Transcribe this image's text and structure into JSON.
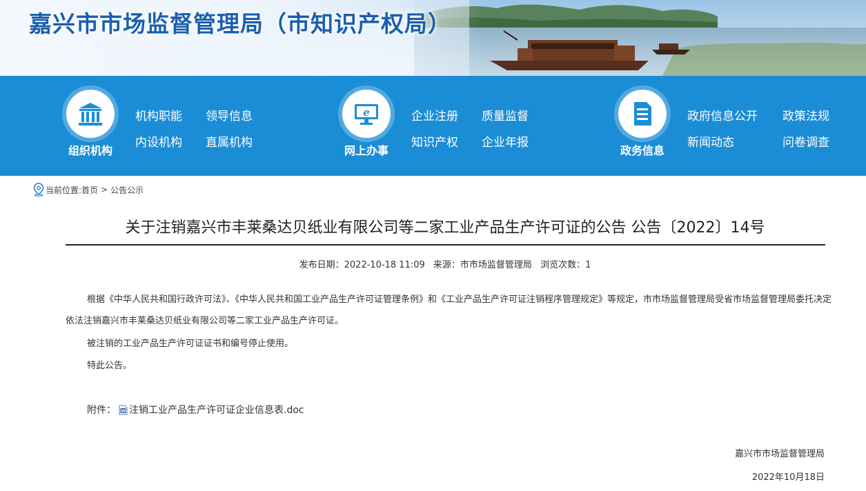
{
  "header": {
    "site_title": "嘉兴市市场监督管理局（市知识产权局）"
  },
  "nav": {
    "groups": [
      {
        "label": "组织机构",
        "icon": "building-columns-icon",
        "links": [
          "机构职能",
          "领导信息",
          "内设机构",
          "直属机构"
        ]
      },
      {
        "label": "网上办事",
        "icon": "monitor-e-icon",
        "links": [
          "企业注册",
          "质量监督",
          "知识产权",
          "企业年报"
        ]
      },
      {
        "label": "政务信息",
        "icon": "document-icon",
        "links": [
          "政府信息公开",
          "政策法规",
          "新闻动态",
          "问卷调查"
        ]
      }
    ]
  },
  "breadcrumb": {
    "prefix": "当前位置:",
    "home": "首页",
    "separator": ">",
    "current": "公告公示"
  },
  "article": {
    "title": "关于注销嘉兴市丰莱桑达贝纸业有限公司等二家工业产品生产许可证的公告 公告〔2022〕14号",
    "publish_date": "发布日期：2022-10-18 11:09",
    "source": "来源：市市场监督管理局",
    "views": "浏览次数：1",
    "paragraphs": [
      "根据《中华人民共和国行政许可法》、《中华人民共和国工业产品生产许可证管理条例》和《工业产品生产许可证注销程序管理规定》等规定，市市场监督管理局受省市场监督管理局委托决定依法注销嘉兴市丰莱桑达贝纸业有限公司等二家工业产品生产许可证。",
      "被注销的工业产品生产许可证证书和编号停止使用。",
      "特此公告。"
    ],
    "attachment_label": "附件：",
    "attachment_name": "注销工业产品生产许可证企业信息表.doc",
    "signature_org": "嘉兴市市场监督管理局",
    "signature_date": "2022年10月18日"
  },
  "colors": {
    "nav_bg": "#1b8dd6",
    "title_blue": "#1a5fae",
    "text": "#333333"
  }
}
